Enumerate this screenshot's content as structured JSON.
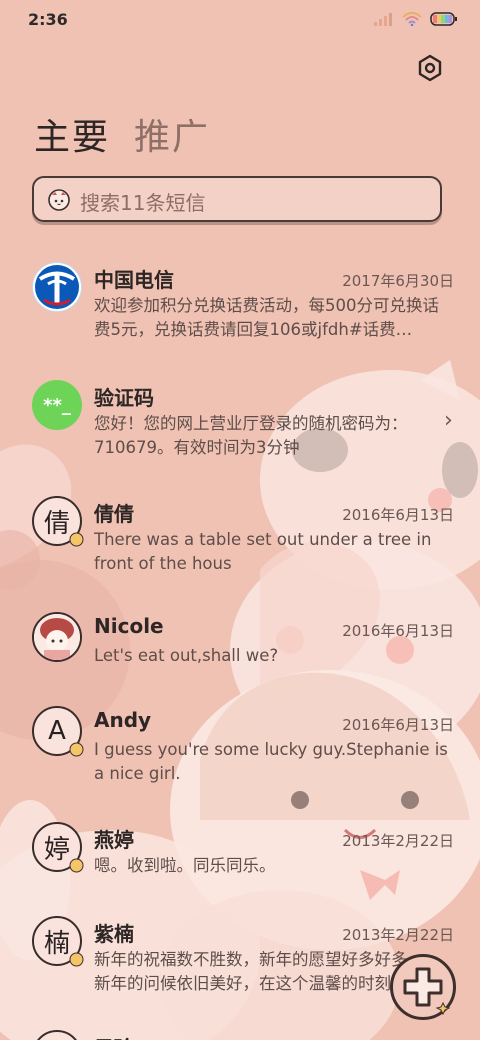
{
  "status_bar": {
    "time": "2:36",
    "battery_icon": "rainbow-battery-icon"
  },
  "header": {
    "settings_icon": "gear-icon",
    "tabs": [
      {
        "label": "主要",
        "active": true
      },
      {
        "label": "推广",
        "active": false
      }
    ]
  },
  "search": {
    "placeholder": "搜索11条短信",
    "icon": "cat-icon"
  },
  "conversations": [
    {
      "name": "中国电信",
      "date": "2017年6月30日",
      "preview": "欢迎参加积分兑换话费活动，每500分可兑换话费5元，兑换话费请回复106或jfdh#话费…",
      "avatar": "china-telecom-logo"
    },
    {
      "name": "验证码",
      "date": "",
      "preview": "您好！您的网上营业厅登录的随机密码为：710679。有效时间为3分钟",
      "avatar_text": "**_",
      "avatar_color": "#6dd458"
    },
    {
      "name": "倩倩",
      "date": "2016年6月13日",
      "preview": "There was a table set out under a tree in front of the hous",
      "avatar_text": "倩"
    },
    {
      "name": "Nicole",
      "date": "2016年6月13日",
      "preview": "Let's eat out,shall we?",
      "avatar": "girl-photo-avatar"
    },
    {
      "name": "Andy",
      "date": "2016年6月13日",
      "preview": "I guess you're some lucky guy.Stephanie is a nice girl.",
      "avatar_text": "A"
    },
    {
      "name": "燕婷",
      "date": "2013年2月22日",
      "preview": "嗯。收到啦。同乐同乐。",
      "avatar_text": "婷"
    },
    {
      "name": "紫楠",
      "date": "2013年2月22日",
      "preview": "新年的祝福数不胜数，新年的愿望好多好多，新年的问候依旧美好，在这个温馨的时刻",
      "avatar_text": "楠"
    },
    {
      "name": "子玲",
      "date": "",
      "preview": "",
      "avatar_text": "玲"
    }
  ],
  "fab": {
    "icon": "plus-icon"
  },
  "colors": {
    "background": "#efc2b4",
    "text_primary": "#2d2624",
    "text_secondary": "#5f4d49",
    "accent_green": "#6dd458",
    "telecom_blue": "#0a58b8"
  }
}
